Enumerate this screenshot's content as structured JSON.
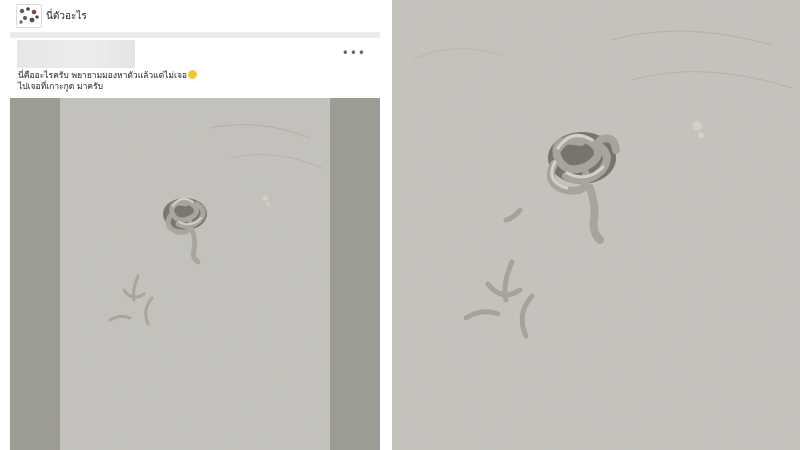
{
  "group": {
    "name": "นี่ตัวอะไร",
    "avatar_icon": "group-avatar-icon"
  },
  "post": {
    "more_label": "•••",
    "text_line1": "นี่คืออะไรครับ พยายามมองหาตัวแล้วแต่ไม่เจอ",
    "text_line2": "ไปเจอที่เกาะกูด มาครับ",
    "emoji_icon": "grinning-face-icon"
  },
  "images": {
    "post_photo": "sand-worm-cast-photo",
    "zoomed_photo": "sand-worm-cast-photo-zoom"
  },
  "colors": {
    "sand": "#c2c0b9",
    "frame": "#9c9c94",
    "cast": "#b9b6ae",
    "shadow": "#6f6c66"
  }
}
